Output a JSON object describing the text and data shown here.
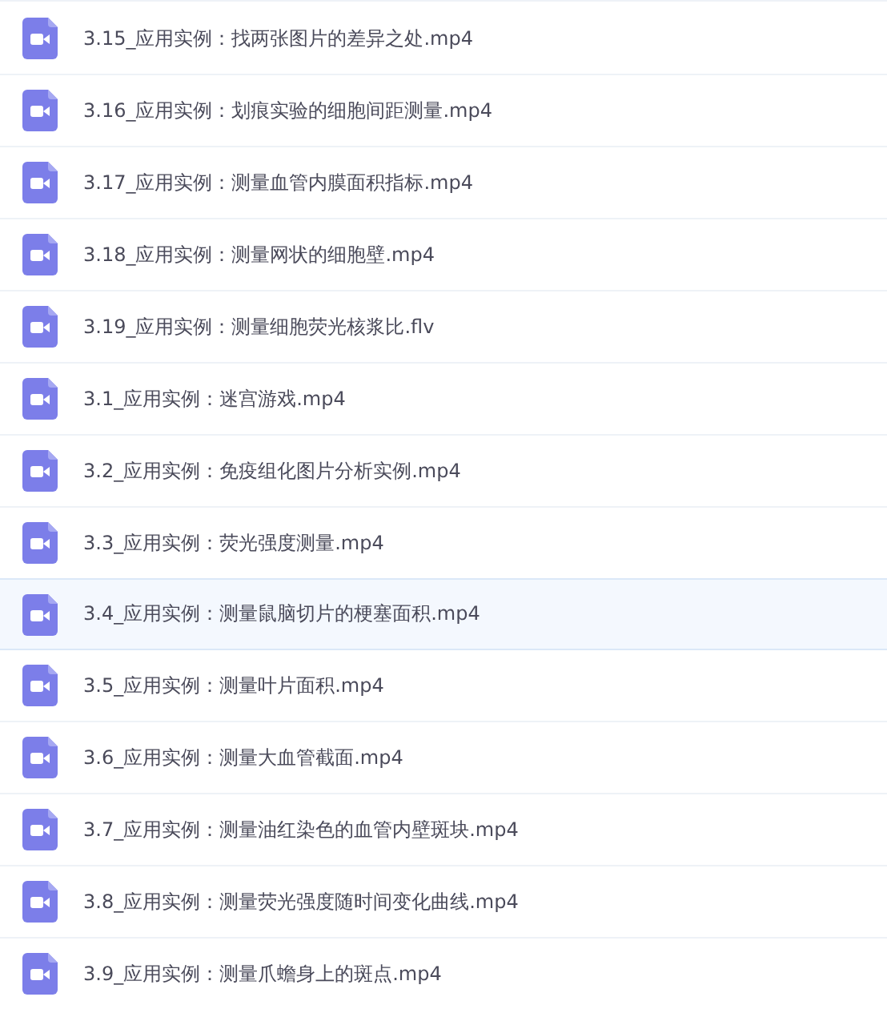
{
  "files": [
    {
      "name": "3.15_应用实例：找两张图片的差异之处.mp4",
      "selected": false
    },
    {
      "name": "3.16_应用实例：划痕实验的细胞间距测量.mp4",
      "selected": false
    },
    {
      "name": "3.17_应用实例：测量血管内膜面积指标.mp4",
      "selected": false
    },
    {
      "name": "3.18_应用实例：测量网状的细胞壁.mp4",
      "selected": false
    },
    {
      "name": "3.19_应用实例：测量细胞荧光核浆比.flv",
      "selected": false
    },
    {
      "name": "3.1_应用实例：迷宫游戏.mp4",
      "selected": false
    },
    {
      "name": "3.2_应用实例：免疫组化图片分析实例.mp4",
      "selected": false
    },
    {
      "name": "3.3_应用实例：荧光强度测量.mp4",
      "selected": false
    },
    {
      "name": "3.4_应用实例：测量鼠脑切片的梗塞面积.mp4",
      "selected": true
    },
    {
      "name": "3.5_应用实例：测量叶片面积.mp4",
      "selected": false
    },
    {
      "name": "3.6_应用实例：测量大血管截面.mp4",
      "selected": false
    },
    {
      "name": "3.7_应用实例：测量油红染色的血管内壁斑块.mp4",
      "selected": false
    },
    {
      "name": "3.8_应用实例：测量荧光强度随时间变化曲线.mp4",
      "selected": false
    },
    {
      "name": "3.9_应用实例：测量爪蟾身上的斑点.mp4",
      "selected": false
    }
  ]
}
